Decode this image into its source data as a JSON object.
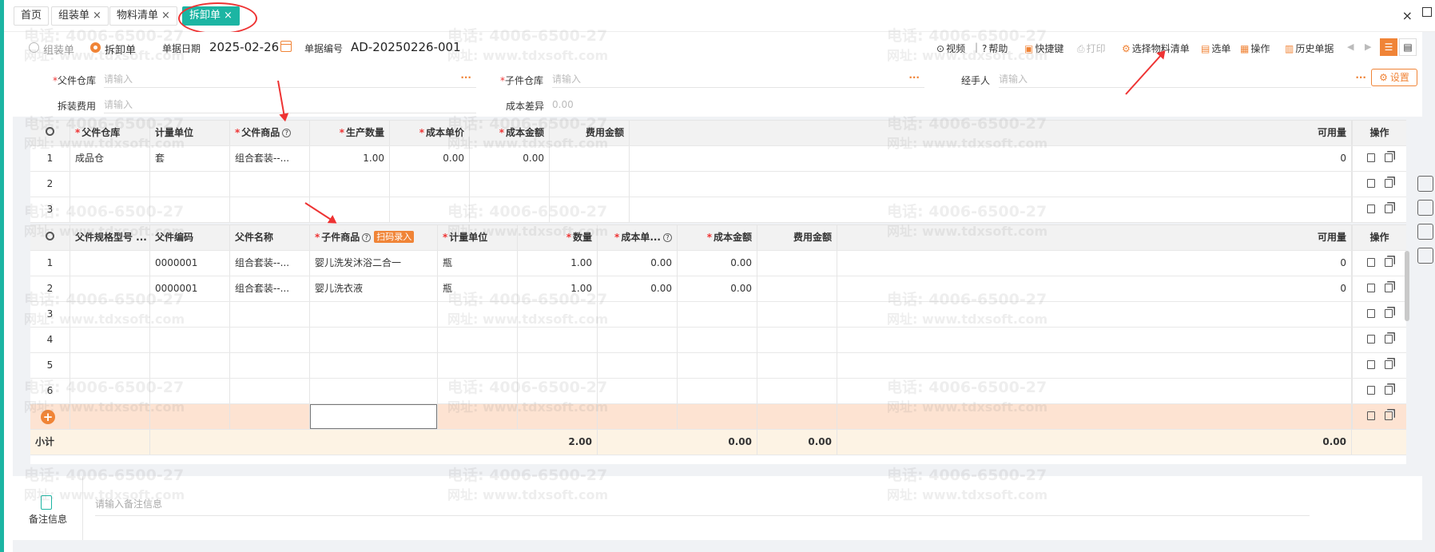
{
  "tabs": [
    {
      "label": "首页",
      "closable": false
    },
    {
      "label": "组装单",
      "closable": true
    },
    {
      "label": "物料清单",
      "closable": true
    },
    {
      "label": "拆卸单",
      "closable": true,
      "active": true
    }
  ],
  "close_glyph": "×",
  "window": {
    "close": "×"
  },
  "toolbar": {
    "radio_assembly": "组装单",
    "radio_disassembly": "拆卸单",
    "selected_mode": "拆卸单",
    "date_label": "单据日期",
    "date_value": "2025-02-26",
    "docno_label": "单据编号",
    "docno_value": "AD-20250226-001",
    "video": "视频",
    "separator": "|",
    "help": "帮助",
    "shortcut": "快捷键",
    "print": "打印",
    "select_bom": "选择物料清单",
    "select_doc": "选单",
    "operation": "操作",
    "history": "历史单据"
  },
  "form": {
    "parent_warehouse_label": "父件仓库",
    "parent_warehouse_placeholder": "请输入",
    "child_warehouse_label": "子件仓库",
    "child_warehouse_placeholder": "请输入",
    "handler_label": "经手人",
    "handler_placeholder": "请输入",
    "fee_label": "拆装费用",
    "fee_placeholder": "请输入",
    "cost_diff_label": "成本差异",
    "cost_diff_value": "0.00",
    "settings": "设置",
    "dots": "···"
  },
  "parent_table": {
    "headers": {
      "parent_warehouse": "父件仓库",
      "unit": "计量单位",
      "parent_goods": "父件商品",
      "qty": "生产数量",
      "unit_cost": "成本单价",
      "cost_amount": "成本金额",
      "fee_amount": "费用金额",
      "available": "可用量",
      "ops": "操作"
    },
    "rows": [
      {
        "no": "1",
        "warehouse": "成品仓",
        "unit": "套",
        "goods": "组合套装--...",
        "qty": "1.00",
        "unit_cost": "0.00",
        "cost_amount": "0.00",
        "fee": "",
        "available": "0"
      },
      {
        "no": "2",
        "warehouse": "",
        "unit": "",
        "goods": "",
        "qty": "",
        "unit_cost": "",
        "cost_amount": "",
        "fee": "",
        "available": ""
      },
      {
        "no": "3",
        "warehouse": "",
        "unit": "",
        "goods": "",
        "qty": "",
        "unit_cost": "",
        "cost_amount": "",
        "fee": "",
        "available": ""
      }
    ]
  },
  "child_table": {
    "headers": {
      "spec": "父件规格型号 ...",
      "parent_code": "父件编码",
      "parent_name": "父件名称",
      "child_goods": "子件商品",
      "scan": "扫码录入",
      "unit": "计量单位",
      "qty": "数量",
      "unit_cost": "成本单...",
      "cost_amount": "成本金额",
      "fee_amount": "费用金额",
      "available": "可用量",
      "ops": "操作"
    },
    "rows": [
      {
        "no": "1",
        "spec": "",
        "code": "0000001",
        "name": "组合套装--...",
        "child": "婴儿洗发沐浴二合一",
        "unit": "瓶",
        "qty": "1.00",
        "unit_cost": "0.00",
        "cost_amount": "0.00",
        "fee": "",
        "available": "0"
      },
      {
        "no": "2",
        "spec": "",
        "code": "0000001",
        "name": "组合套装--...",
        "child": "婴儿洗衣液",
        "unit": "瓶",
        "qty": "1.00",
        "unit_cost": "0.00",
        "cost_amount": "0.00",
        "fee": "",
        "available": "0"
      },
      {
        "no": "3"
      },
      {
        "no": "4"
      },
      {
        "no": "5"
      },
      {
        "no": "6"
      }
    ],
    "add_glyph": "+",
    "total": {
      "label": "小计",
      "qty": "2.00",
      "cost_amount": "0.00",
      "fee": "0.00",
      "available": "0.00"
    }
  },
  "remark": {
    "label": "备注信息",
    "placeholder": "请输入备注信息"
  },
  "watermark": {
    "phone": "电话: 4006-6500-27",
    "site": "网址: www.tdxsoft.com"
  },
  "colors": {
    "accent": "#f08437",
    "teal": "#1cb5a3",
    "required": "#e33333"
  }
}
